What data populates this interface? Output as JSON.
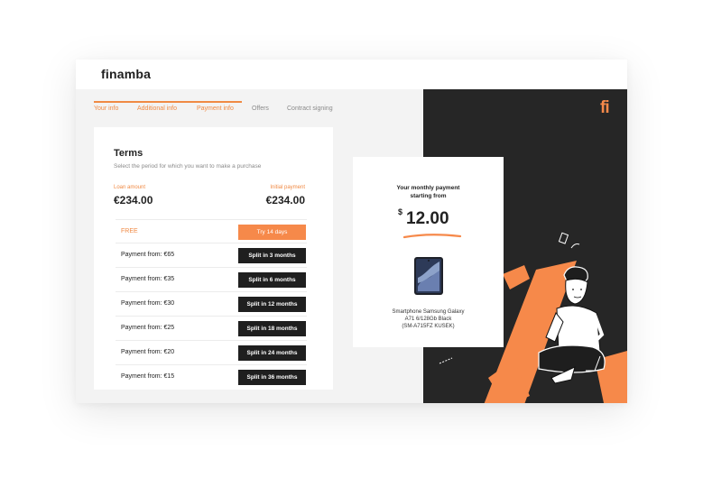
{
  "brand": {
    "name": "finamba",
    "mark": "fi",
    "accent": "#f6894a",
    "dark": "#262626"
  },
  "steps": [
    {
      "label": "Your info",
      "state": "done"
    },
    {
      "label": "Additional info",
      "state": "done"
    },
    {
      "label": "Payment info",
      "state": "done"
    },
    {
      "label": "Offers",
      "state": "todo"
    },
    {
      "label": "Contract signing",
      "state": "todo"
    }
  ],
  "terms": {
    "title": "Terms",
    "subtitle": "Select the period for which you want to make a purchase",
    "loan_label": "Loan amount",
    "loan_value": "€234.00",
    "initial_label": "Initial payment",
    "initial_value": "€234.00",
    "free_option": {
      "label": "FREE",
      "button": "Try 14 days"
    },
    "options": [
      {
        "label": "Payment from:",
        "amount": "€65",
        "button": "Split in 3 months"
      },
      {
        "label": "Payment from:",
        "amount": "€35",
        "button": "Split in 6 months"
      },
      {
        "label": "Payment from:",
        "amount": "€30",
        "button": "Split in 12 months"
      },
      {
        "label": "Payment from:",
        "amount": "€25",
        "button": "Split in 18 months"
      },
      {
        "label": "Payment from:",
        "amount": "€20",
        "button": "Split in 24 months"
      },
      {
        "label": "Payment from:",
        "amount": "€15",
        "button": "Split in 36 months"
      }
    ]
  },
  "payment": {
    "title_line1": "Your monthly payment",
    "title_line2": "starting from",
    "currency": "$",
    "amount": "12.00",
    "product_line1": "Smartphone Samsung Galaxy",
    "product_line2": "A71 6/128Gb Black",
    "product_line3": "(SM-A715FZ KUSEK)",
    "product_icon": "smartphone-icon"
  }
}
